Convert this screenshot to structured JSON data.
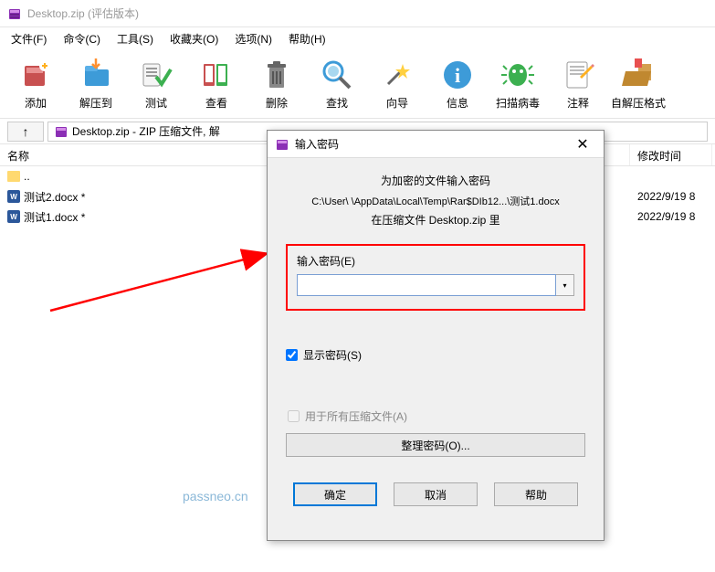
{
  "titlebar": {
    "text": "Desktop.zip (评估版本)"
  },
  "menu": {
    "file": "文件(F)",
    "cmd": "命令(C)",
    "tools": "工具(S)",
    "fav": "收藏夹(O)",
    "opt": "选项(N)",
    "help": "帮助(H)"
  },
  "toolbar": {
    "add": "添加",
    "extract": "解压到",
    "test": "测试",
    "view": "查看",
    "delete": "删除",
    "find": "查找",
    "wizard": "向导",
    "info": "信息",
    "scan": "扫描病毒",
    "comment": "注释",
    "sfx": "自解压格式"
  },
  "pathbar": {
    "text": "Desktop.zip - ZIP 压缩文件, 解"
  },
  "columns": {
    "name": "名称",
    "date": "修改时间"
  },
  "rows": {
    "up": "..",
    "f1": {
      "name": "测试2.docx *",
      "date": "2022/9/19 8"
    },
    "f2": {
      "name": "测试1.docx *",
      "date": "2022/9/19 8"
    }
  },
  "dialog": {
    "title": "输入密码",
    "heading": "为加密的文件输入密码",
    "path": "C:\\User\\              \\AppData\\Local\\Temp\\Rar$DIb12...\\测试1.docx",
    "sub": "在压缩文件 Desktop.zip 里",
    "input_label": "输入密码(E)",
    "show_pw": "显示密码(S)",
    "all_files": "用于所有压缩文件(A)",
    "organize": "整理密码(O)...",
    "ok": "确定",
    "cancel": "取消",
    "help": "帮助"
  },
  "watermark": "passneo.cn"
}
